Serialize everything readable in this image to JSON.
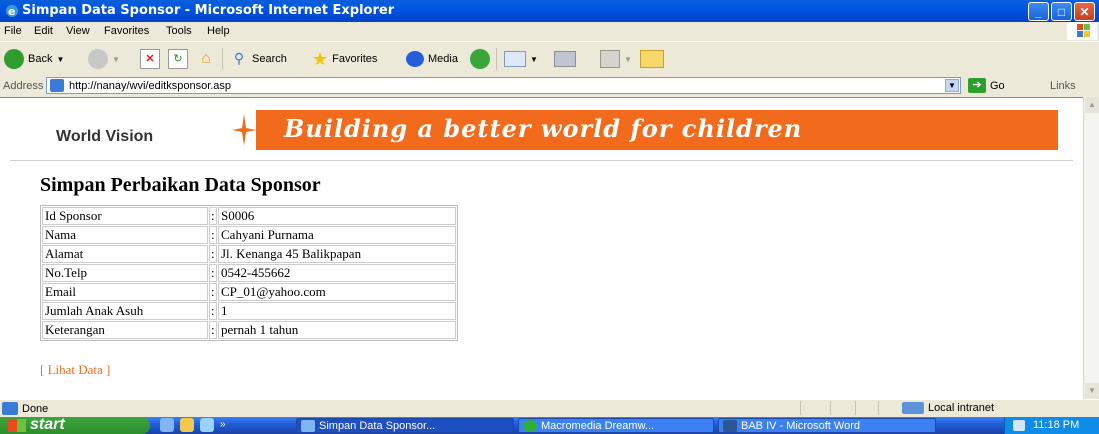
{
  "window": {
    "title": "Simpan Data Sponsor - Microsoft Internet Explorer",
    "controls": {
      "minimize": "_",
      "maximize": "□",
      "close": "✕"
    }
  },
  "menu": [
    "File",
    "Edit",
    "View",
    "Favorites",
    "Tools",
    "Help"
  ],
  "toolbar": {
    "back_label": "Back",
    "search_label": "Search",
    "favorites_label": "Favorites",
    "media_label": "Media"
  },
  "address": {
    "label": "Address",
    "url": "http://nanay/wvi/editksponsor.asp",
    "go_label": "Go",
    "links_label": "Links"
  },
  "banner": {
    "logo_text": "World Vision",
    "slogan": "Building a better world for children",
    "accent_color": "#f26b1d"
  },
  "page": {
    "title": "Simpan Perbaikan Data Sponsor",
    "rows": [
      {
        "label": "Id Sponsor",
        "value": "S0006"
      },
      {
        "label": "Nama",
        "value": "Cahyani Purnama"
      },
      {
        "label": "Alamat",
        "value": "Jl. Kenanga 45 Balikpapan"
      },
      {
        "label": "No.Telp",
        "value": "0542-455662"
      },
      {
        "label": "Email",
        "value": "CP_01@yahoo.com"
      },
      {
        "label": "Jumlah Anak Asuh",
        "value": "1"
      },
      {
        "label": "Keterangan",
        "value": "pernah 1 tahun"
      }
    ],
    "separator": ":",
    "link_text": "[ Lihat Data ]"
  },
  "status": {
    "text": "Done",
    "zone": "Local intranet"
  },
  "taskbar": {
    "start_label": "start",
    "tasks": [
      {
        "label": "Simpan Data Sponsor...",
        "icon": "ie-icon",
        "active": true
      },
      {
        "label": "Macromedia Dreamw...",
        "icon": "dreamweaver-icon",
        "active": false
      },
      {
        "label": "BAB IV - Microsoft Word",
        "icon": "word-icon",
        "active": false
      }
    ],
    "clock": "11:18 PM",
    "chevron": "»"
  }
}
